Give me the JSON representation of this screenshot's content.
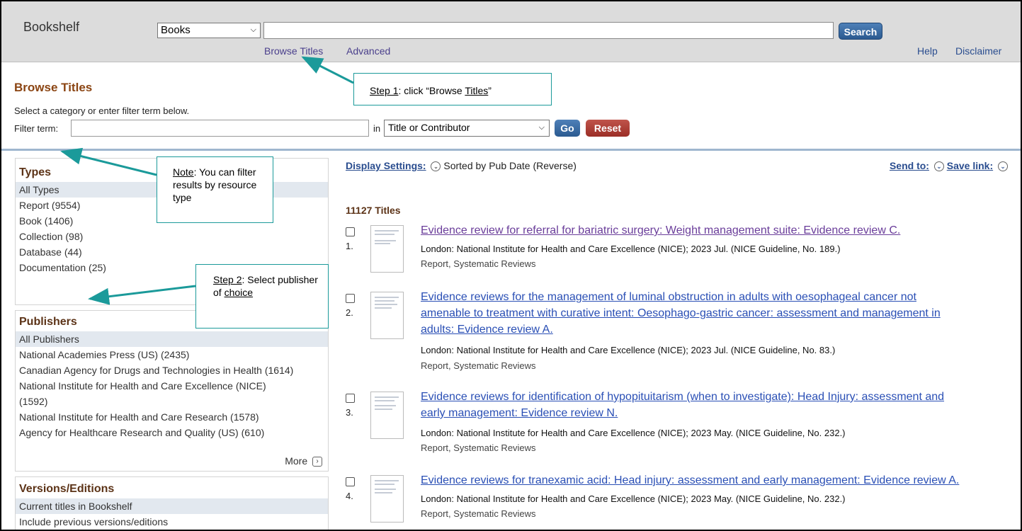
{
  "header": {
    "logo": "Bookshelf",
    "db_select": "Books",
    "search_button": "Search",
    "links": {
      "browse_titles": "Browse Titles",
      "advanced": "Advanced",
      "help": "Help",
      "disclaimer": "Disclaimer"
    }
  },
  "browse": {
    "title": "Browse Titles",
    "description": "Select a category or enter filter term below.",
    "filter_label": "Filter term:",
    "in_label": "in",
    "field_select": "Title or Contributor",
    "go": "Go",
    "reset": "Reset"
  },
  "facets": {
    "types": {
      "title": "Types",
      "items": [
        "All Types",
        "Report (9554)",
        "Book (1406)",
        "Collection (98)",
        "Database (44)",
        "Documentation (25)"
      ]
    },
    "publishers": {
      "title": "Publishers",
      "items": [
        "All Publishers",
        "National Academies Press (US) (2435)",
        "Canadian Agency for Drugs and Technologies in Health (1614)",
        "National Institute for Health and Care Excellence (NICE)",
        "(1592)",
        "National Institute for Health and Care Research (1578)",
        "Agency for Healthcare Research and Quality (US) (610)"
      ],
      "more": "More"
    },
    "versions": {
      "title": "Versions/Editions",
      "items": [
        "Current titles in Bookshelf",
        "Include previous versions/editions"
      ]
    }
  },
  "results_header": {
    "display_settings": "Display Settings:",
    "sort": "Sorted by Pub Date (Reverse)",
    "send_to": "Send to:",
    "save_link": "Save link:",
    "count": "11127 Titles"
  },
  "results": [
    {
      "num": "1.",
      "title_lines": [
        "Evidence review for referral for bariatric surgery: Weight management suite: Evidence review C."
      ],
      "source": "London: National Institute for Health and Care Excellence (NICE); 2023 Jul. (NICE Guideline, No. 189.)",
      "kind": "Report, Systematic Reviews"
    },
    {
      "num": "2.",
      "title_lines": [
        "Evidence reviews for the management of luminal obstruction in adults with oesophageal cancer not",
        "amenable to treatment with curative intent: Oesophago-gastric cancer: assessment and management in",
        "adults: Evidence review A."
      ],
      "source": "London: National Institute for Health and Care Excellence (NICE); 2023 Jul. (NICE Guideline, No. 83.)",
      "kind": "Report, Systematic Reviews"
    },
    {
      "num": "3.",
      "title_lines": [
        "Evidence reviews for identification of hypopituitarism (when to investigate): Head Injury: assessment and",
        "early management: Evidence review N."
      ],
      "source": "London: National Institute for Health and Care Excellence (NICE); 2023 May. (NICE Guideline, No. 232.)",
      "kind": "Report, Systematic Reviews"
    },
    {
      "num": "4.",
      "title_lines": [
        "Evidence reviews for tranexamic acid: Head injury: assessment and early management: Evidence review A."
      ],
      "source": "London: National Institute for Health and Care Excellence (NICE); 2023 May. (NICE Guideline, No. 232.)",
      "kind": "Report, Systematic Reviews"
    }
  ],
  "annotations": {
    "step1": {
      "lead": "Step 1",
      "mid": ": click “Browse ",
      "link": "Titles",
      "tail": "”"
    },
    "note": {
      "lead": "Note",
      "rest": ": You can filter results by resource type"
    },
    "step2": {
      "lead": "Step 2",
      "rest": ": Select publisher of ",
      "link": "choice"
    }
  },
  "icons": {
    "chevron": "chevron-down-icon",
    "more": "chevron-right-icon"
  },
  "colors": {
    "accent": "#2a4d8f",
    "heading": "#8b4513",
    "callout_border": "#1b9a9a",
    "reset": "#9b2e26"
  }
}
